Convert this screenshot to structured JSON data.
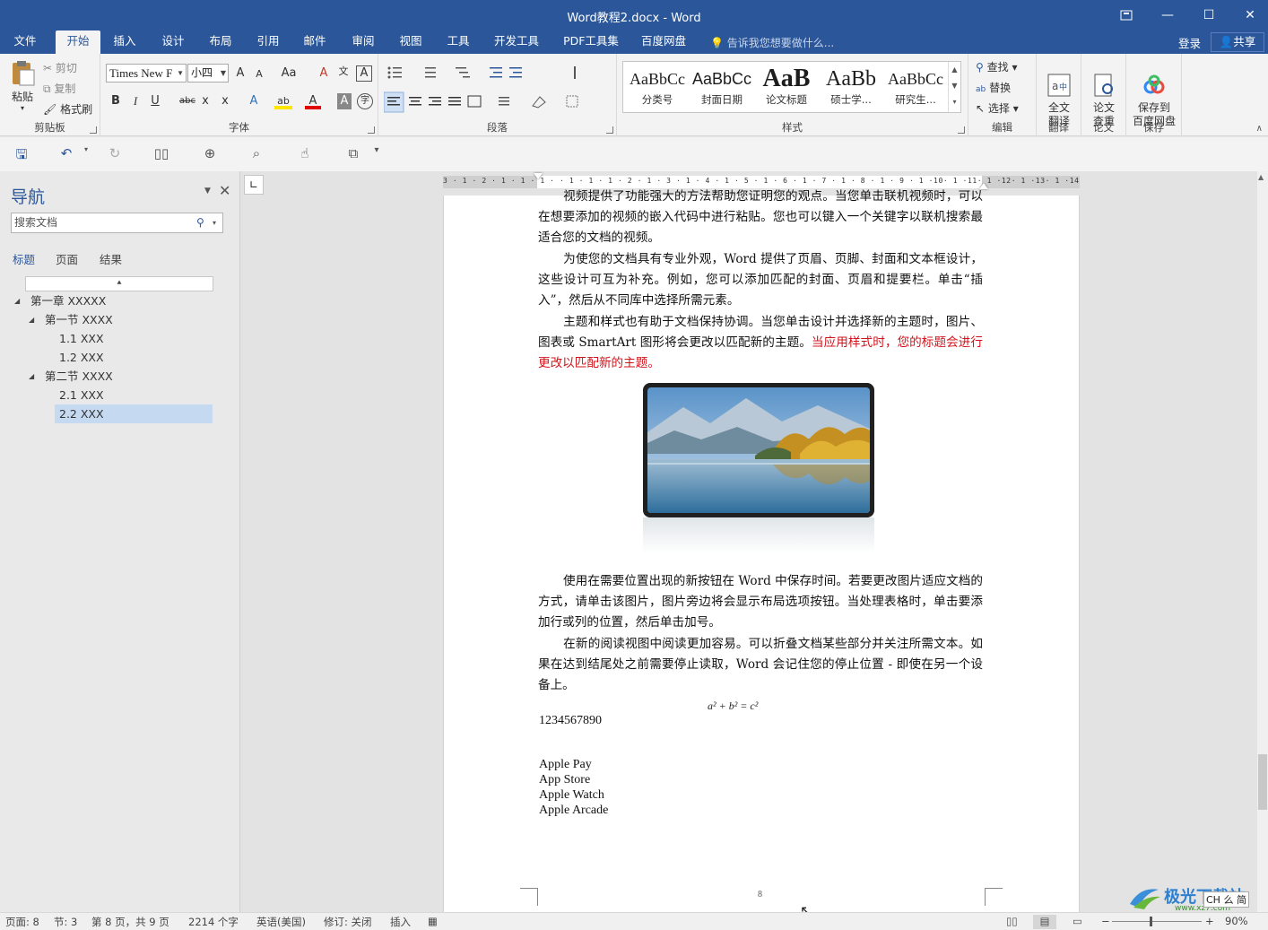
{
  "window": {
    "title": "Word教程2.docx - Word",
    "restore_icon": "ribbon-display-icon",
    "minimize": "—",
    "maximize": "☐",
    "close": "✕"
  },
  "tabs": [
    "文件",
    "开始",
    "插入",
    "设计",
    "布局",
    "引用",
    "邮件",
    "审阅",
    "视图",
    "工具",
    "开发工具",
    "PDF工具集",
    "百度网盘"
  ],
  "active_tab": "开始",
  "tellme": "告诉我您想要做什么...",
  "account": {
    "login": "登录",
    "share": "共享"
  },
  "ribbon": {
    "clipboard": {
      "label": "剪贴板",
      "paste": "粘贴",
      "cut": "剪切",
      "copy": "复制",
      "format_painter": "格式刷"
    },
    "font": {
      "label": "字体",
      "font_name": "Times New F",
      "font_size": "小四",
      "grow": "A",
      "shrink": "A",
      "case": "Aa",
      "clear": "A",
      "pinyin": "文",
      "border_char": "A",
      "bold": "B",
      "italic": "I",
      "underline": "U",
      "strike": "abc",
      "sub": "x",
      "super": "x",
      "effects": "A",
      "highlight": "ab",
      "font_color": "A",
      "shade": "A",
      "enclose": "字"
    },
    "paragraph": {
      "label": "段落"
    },
    "styles": {
      "label": "样式",
      "items": [
        {
          "sample": "AaBbCc",
          "name": "分类号"
        },
        {
          "sample": "AaBbCc",
          "name": "封面日期"
        },
        {
          "sample": "AaB",
          "name": "论文标题"
        },
        {
          "sample": "AaBb",
          "name": "硕士学..."
        },
        {
          "sample": "AaBbCc",
          "name": "研究生..."
        }
      ]
    },
    "editing": {
      "label": "编辑",
      "find": "查找",
      "replace": "替换",
      "select": "选择"
    },
    "translate": {
      "label": "翻译",
      "full": "全文\n翻译"
    },
    "paper": {
      "label": "论文",
      "check": "论文\n查重"
    },
    "save": {
      "label": "保存",
      "baidu": "保存到\n百度网盘"
    }
  },
  "nav": {
    "title": "导航",
    "search_placeholder": "搜索文档",
    "tabs": [
      "标题",
      "页面",
      "结果"
    ],
    "tree": [
      {
        "text": "第一章 XXXXX",
        "level": 0,
        "arrow": "◢"
      },
      {
        "text": "第一节 XXXX",
        "level": 1,
        "arrow": "◢"
      },
      {
        "text": "1.1 XXX",
        "level": 2
      },
      {
        "text": "1.2 XXX",
        "level": 2
      },
      {
        "text": "第二节 XXXX",
        "level": 1,
        "arrow": "◢"
      },
      {
        "text": "2.1 XXX",
        "level": 2
      },
      {
        "text": "2.2 XXX",
        "level": 2,
        "selected": true
      }
    ]
  },
  "ruler": "3 · 1 · 2 · 1 · 1 · 1 ·   · 1 · 1 · 1 · 2 · 1 · 3 · 1 · 4 · 1 · 5 · 1 · 6 · 1 · 7 · 1 · 8 · 1 · 9 · 1 ·10· 1 ·11· 1 ·12· 1 ·13· 1 ·14· 1 ·15· 1 ·16· 1 ·17· 1",
  "document": {
    "p0": "视频提供了功能强大的方法帮助您证明您的观点。当您单击联机视频时，可以在想要添加的视频的嵌入代码中进行粘贴。您也可以键入一个关键字以联机搜索最适合您的文档的视频。",
    "p1": "为使您的文档具有专业外观，Word 提供了页眉、页脚、封面和文本框设计，这些设计可互为补充。例如，您可以添加匹配的封面、页眉和提要栏。单击“插入”，然后从不同库中选择所需元素。",
    "p2a": "主题和样式也有助于文档保持协调。当您单击设计并选择新的主题时，图片、图表或 SmartArt 图形将会更改以匹配新的主题。",
    "p2b": "当应用样式时，您的标题会进行更改以匹配新的主题。",
    "p3": "使用在需要位置出现的新按钮在 Word 中保存时间。若要更改图片适应文档的方式，请单击该图片，图片旁边将会显示布局选项按钮。当处理表格时，单击要添加行或列的位置，然后单击加号。",
    "p4": "在新的阅读视图中阅读更加容易。可以折叠文档某些部分并关注所需文本。如果在达到结尾处之前需要停止读取，Word 会记住您的停止位置 - 即使在另一个设备上。",
    "equation": "a² + b² = c²",
    "number": "1234567890",
    "list": [
      "Apple Pay",
      "App Store",
      "Apple Watch",
      "Apple Arcade"
    ],
    "page_number": "8"
  },
  "status": {
    "page": "页面: 8",
    "section": "节: 3",
    "pages": "第 8 页，共 9 页",
    "words": "2214 个字",
    "lang": "英语(美国)",
    "track": "修订: 关闭",
    "mode": "插入",
    "zoom": "90%"
  },
  "watermark": {
    "brand": "极光下载站",
    "url": "www.xz7.com",
    "ime": "CH 么 简"
  }
}
